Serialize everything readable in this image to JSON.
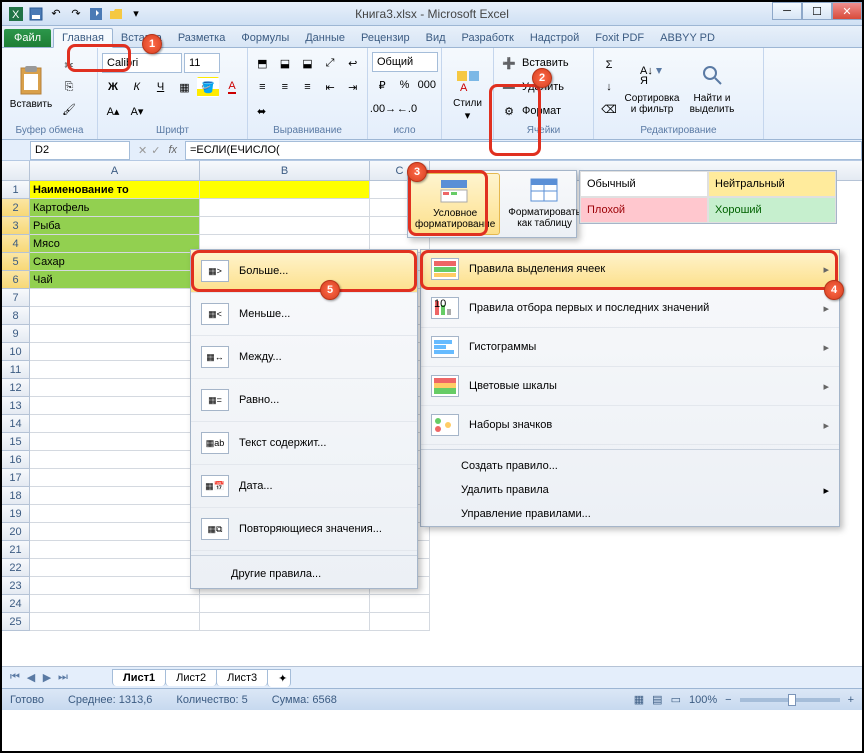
{
  "title": "Книга3.xlsx - Microsoft Excel",
  "tabs": {
    "file": "Файл",
    "home": "Главная",
    "insert": "Вставка",
    "layout": "Разметка",
    "formulas": "Формулы",
    "data": "Данные",
    "review": "Рецензир",
    "view": "Вид",
    "developer": "Разработк",
    "addins": "Надстрой",
    "foxit": "Foxit PDF",
    "abbyy": "ABBYY PD"
  },
  "ribbon": {
    "clipboard": {
      "paste": "Вставить",
      "label": "Буфер обмена"
    },
    "font": {
      "name": "Calibri",
      "size": "11",
      "label": "Шрифт"
    },
    "alignment": {
      "label": "Выравнивание"
    },
    "number": {
      "format": "Общий",
      "label": "исло"
    },
    "styles": {
      "btn": "Стили"
    },
    "cells": {
      "insert": "Вставить",
      "delete": "Удалить",
      "format": "Формат",
      "label": "Ячейки"
    },
    "editing": {
      "sort": "Сортировка и фильтр",
      "find": "Найти и выделить",
      "label": "Редактирование"
    }
  },
  "namebox": "D2",
  "formula": "=ЕСЛИ(ЕЧИСЛО(",
  "columns": [
    "A",
    "B",
    "C"
  ],
  "header_row": {
    "a": "Наименование то"
  },
  "data_rows": [
    {
      "n": "2",
      "a": "Картофель"
    },
    {
      "n": "3",
      "a": "Рыба"
    },
    {
      "n": "4",
      "a": "Мясо"
    },
    {
      "n": "5",
      "a": "Сахар"
    },
    {
      "n": "6",
      "a": "Чай"
    }
  ],
  "empty_rows": [
    "7",
    "8",
    "9",
    "10",
    "11",
    "12",
    "13",
    "14",
    "15",
    "16",
    "17",
    "18",
    "19",
    "20",
    "21",
    "22",
    "23",
    "24",
    "25"
  ],
  "sheets": {
    "s1": "Лист1",
    "s2": "Лист2",
    "s3": "Лист3"
  },
  "status": {
    "ready": "Готово",
    "avg": "Среднее: 1313,6",
    "count": "Количество: 5",
    "sum": "Сумма: 6568",
    "zoom": "100%"
  },
  "styles_dd": {
    "cf": "Условное форматирование",
    "fat": "Форматировать как таблицу"
  },
  "gallery": {
    "normal": "Обычный",
    "neutral": "Нейтральный",
    "bad": "Плохой",
    "good": "Хороший"
  },
  "cf_menu": {
    "highlight": "Правила выделения ячеек",
    "toprules": "Правила отбора первых и последних значений",
    "databars": "Гистограммы",
    "colorscales": "Цветовые шкалы",
    "iconsets": "Наборы значков",
    "newrule": "Создать правило...",
    "clear": "Удалить правила",
    "manage": "Управление правилами..."
  },
  "hl_menu": {
    "greater": "Больше...",
    "less": "Меньше...",
    "between": "Между...",
    "equal": "Равно...",
    "textcontains": "Текст содержит...",
    "date": "Дата...",
    "duplicate": "Повторяющиеся значения...",
    "more": "Другие правила..."
  }
}
